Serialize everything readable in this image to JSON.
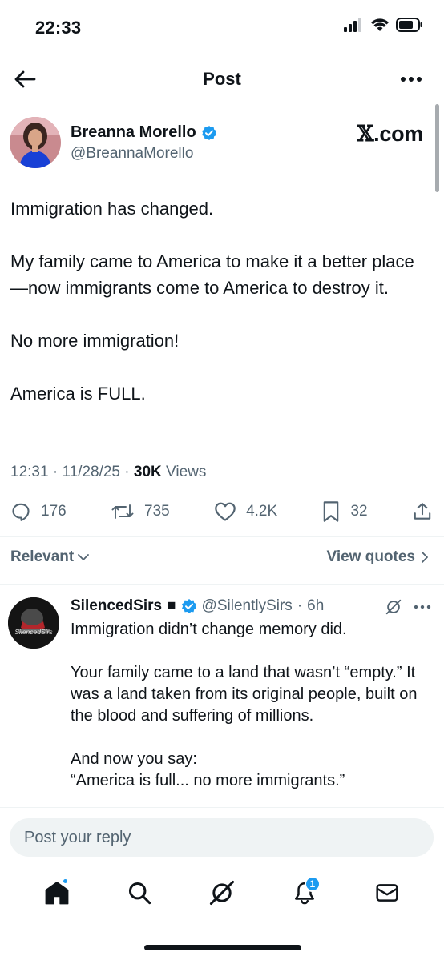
{
  "status_bar": {
    "time": "22:33"
  },
  "header": {
    "title": "Post"
  },
  "post": {
    "author_name": "Breanna Morello",
    "author_handle": "@BreannaMorello",
    "watermark": "X.com",
    "watermark_letter": "𝕏",
    "watermark_suffix": ".com",
    "paragraphs": [
      "Immigration has changed.",
      "My family came to America to make it a better place—now immigrants come to America to destroy it.",
      "No more immigration!",
      "America is FULL."
    ],
    "time": "12:31",
    "date": "11/28/25",
    "views_count": "30K",
    "views_label": "Views",
    "stats": {
      "replies": "176",
      "reposts": "735",
      "likes": "4.2K",
      "bookmarks": "32"
    }
  },
  "filters": {
    "relevant_label": "Relevant",
    "view_quotes_label": "View quotes"
  },
  "reply": {
    "avatar_text": "SilencedSirs",
    "author_name": "SilencedSirs",
    "author_suffix": "■",
    "author_handle": "@SilentlySirs",
    "time": "6h",
    "paragraphs": [
      "Immigration didn’t change memory did.",
      "Your family came to a land that wasn’t “empty.” It was a land taken from its original people, built on the blood and suffering of millions.",
      "And now you say:"
    ],
    "quote_line": "“America is full... no more immigrants.”"
  },
  "composer": {
    "placeholder": "Post your reply"
  },
  "bottom_nav": {
    "notifications_badge": "1"
  },
  "colors": {
    "accent": "#1d9bf0",
    "text_primary": "#0f1419",
    "text_secondary": "#536471",
    "divider": "#eff3f4"
  }
}
